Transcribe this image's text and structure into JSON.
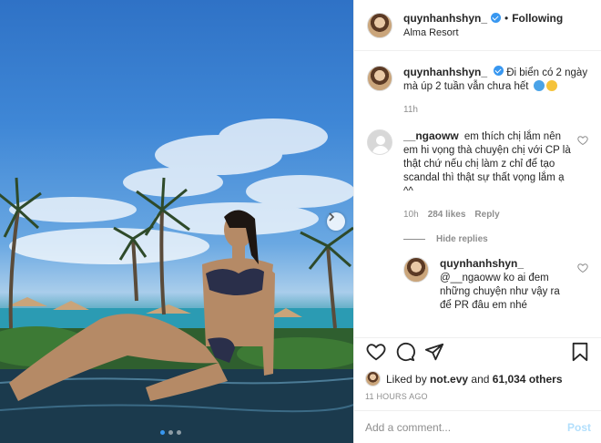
{
  "header": {
    "username": "quynhanhshyn_",
    "separator": "•",
    "follow_status": "Following",
    "location": "Alma Resort"
  },
  "caption": {
    "username": "quynhanhshyn_",
    "text": "Đi biển có 2 ngày mà úp 2 tuần vẫn chưa hết",
    "emojis": [
      "wave-emoji",
      "grinning-emoji"
    ],
    "time": "11h"
  },
  "comments": [
    {
      "username": "__ngaoww",
      "text": "em thích chị lắm nên em hi vọng thà chuyện chị với CP là thật chứ nếu chị làm z chỉ để tạo scandal thì thật sự thất vọng lắm ạ ^^",
      "time": "10h",
      "likes": "284 likes",
      "reply_label": "Reply"
    }
  ],
  "hide_replies_label": "Hide replies",
  "reply": {
    "username": "quynhanhshyn_",
    "text": "@__ngaoww ko ai đem những chuyện như vậy ra để PR đâu em nhé"
  },
  "liked_by": {
    "prefix": "Liked by",
    "user": "not.evy",
    "middle": "and",
    "others": "61,034 others"
  },
  "timestamp": "11 HOURS AGO",
  "add_comment": {
    "placeholder": "Add a comment...",
    "post_label": "Post"
  },
  "carousel": {
    "slides": 3,
    "active": 1
  },
  "colors": {
    "accent": "#3897f0",
    "post_disabled": "#b2dffc",
    "muted": "#8e8e8e"
  },
  "icons": [
    "heart-icon",
    "comment-icon",
    "share-icon",
    "bookmark-icon",
    "verified-icon",
    "chevron-right-icon"
  ]
}
